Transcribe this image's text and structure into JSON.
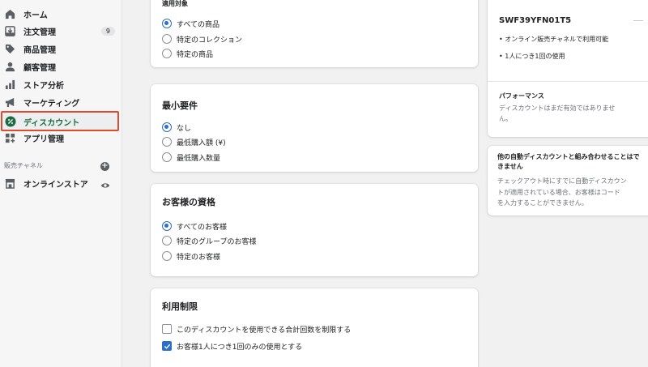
{
  "sidebar": {
    "items": [
      {
        "label": "ホーム",
        "icon": "home-icon"
      },
      {
        "label": "注文管理",
        "icon": "orders-icon",
        "badge": "9"
      },
      {
        "label": "商品管理",
        "icon": "tag-icon"
      },
      {
        "label": "顧客管理",
        "icon": "person-icon"
      },
      {
        "label": "ストア分析",
        "icon": "analytics-icon"
      },
      {
        "label": "マーケティング",
        "icon": "megaphone-icon"
      },
      {
        "label": "ディスカウント",
        "icon": "discount-icon"
      },
      {
        "label": "アプリ管理",
        "icon": "apps-icon"
      }
    ],
    "sales_channels_title": "販売チャネル",
    "online_store_label": "オンラインストア"
  },
  "applies_to": {
    "title": "適用対象",
    "options": [
      "すべての商品",
      "特定のコレクション",
      "特定の商品"
    ],
    "selected": 0
  },
  "min_requirements": {
    "title": "最小要件",
    "options": [
      "なし",
      "最低購入額 (¥)",
      "最低購入数量"
    ],
    "selected": 0
  },
  "customer_eligibility": {
    "title": "お客様の資格",
    "options": [
      "すべてのお客様",
      "特定のグループのお客様",
      "特定のお客様"
    ],
    "selected": 0
  },
  "usage_limits": {
    "title": "利用制限",
    "options": [
      {
        "label": "このディスカウントを使用できる合計回数を制限する",
        "checked": false
      },
      {
        "label": "お客様1人につき1回のみの使用とする",
        "checked": true
      }
    ]
  },
  "summary": {
    "code": "SWF39YFN01T5",
    "bullets": [
      "オンライン販売チャネルで利用可能",
      "1人につき1回の使用"
    ],
    "performance_title": "パフォーマンス",
    "performance_text_1": "ディスカウントはまだ有効ではありませ",
    "performance_text_2": "ん。",
    "combine_title_1": "他の自動ディスカウントと組み合わせることはで",
    "combine_title_2": "きません",
    "combine_text_1": "チェックアウト時にすでに自動ディスカウン",
    "combine_text_2": "トが適用されている場合、お客様はコード",
    "combine_text_3": "を入力することができません。"
  },
  "colors": {
    "accent": "#2c6ecb",
    "highlight_border": "#e04b2f",
    "active_label": "#1c6b45"
  }
}
